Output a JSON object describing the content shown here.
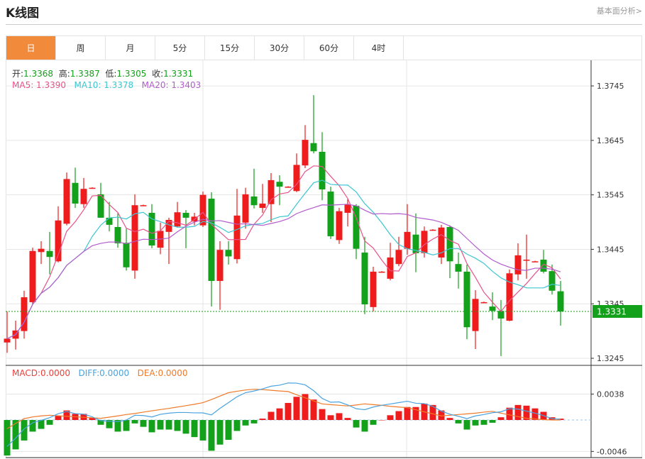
{
  "header": {
    "title": "K线图",
    "link": "基本面分析>"
  },
  "tabs": [
    {
      "label": "日",
      "active": true
    },
    {
      "label": "周"
    },
    {
      "label": "月"
    },
    {
      "label": "5分"
    },
    {
      "label": "15分"
    },
    {
      "label": "30分"
    },
    {
      "label": "60分"
    },
    {
      "label": "4时"
    }
  ],
  "ohlc_info": {
    "open_label": "开:",
    "open": "1.3368",
    "high_label": "高:",
    "high": "1.3387",
    "low_label": "低:",
    "low": "1.3305",
    "close_label": "收:",
    "close": "1.3331"
  },
  "ma_info": {
    "ma5": "MA5: 1.3390",
    "ma10": "MA10: 1.3378",
    "ma20": "MA20: 1.3403"
  },
  "macd_info": {
    "macd": "MACD:0.0000",
    "diff": "DIFF:0.0000",
    "dea": "DEA:0.0000"
  },
  "colors": {
    "up": "#ee1c1c",
    "down": "#13a01a",
    "ma5": "#e8528a",
    "ma10": "#3cc6d0",
    "ma20": "#b25ccc",
    "diff": "#4aa3df",
    "dea": "#f07a2a",
    "accent": "#f28a3c"
  },
  "chart_data": [
    {
      "type": "candlestick",
      "ylim": [
        1.3232,
        1.3792
      ],
      "y_ticks": [
        "1.3745",
        "1.3645",
        "1.3545",
        "1.3445",
        "1.3345",
        "1.3245"
      ],
      "current_price": "1.3331",
      "grid": true,
      "ma_periods": [
        5,
        10,
        20
      ],
      "candles": [
        [
          1.3274,
          1.3331,
          1.3255,
          1.3281
        ],
        [
          1.3281,
          1.3314,
          1.3261,
          1.3296
        ],
        [
          1.3295,
          1.3369,
          1.3281,
          1.3357
        ],
        [
          1.3348,
          1.3448,
          1.3344,
          1.3442
        ],
        [
          1.344,
          1.346,
          1.3418,
          1.3446
        ],
        [
          1.3442,
          1.3477,
          1.3399,
          1.3431
        ],
        [
          1.3423,
          1.3524,
          1.3421,
          1.3498
        ],
        [
          1.3492,
          1.3586,
          1.3489,
          1.3574
        ],
        [
          1.3567,
          1.3595,
          1.3521,
          1.3529
        ],
        [
          1.3528,
          1.3576,
          1.3521,
          1.3556
        ],
        [
          1.3558,
          1.3559,
          1.3557,
          1.3558
        ],
        [
          1.3546,
          1.3567,
          1.3503,
          1.3503
        ],
        [
          1.3503,
          1.3532,
          1.3478,
          1.349
        ],
        [
          1.3486,
          1.3511,
          1.3448,
          1.3456
        ],
        [
          1.3457,
          1.3483,
          1.3406,
          1.3412
        ],
        [
          1.3406,
          1.3546,
          1.3391,
          1.3526
        ],
        [
          1.3526,
          1.3527,
          1.3525,
          1.3526
        ],
        [
          1.3512,
          1.3528,
          1.3447,
          1.3452
        ],
        [
          1.3448,
          1.3494,
          1.3436,
          1.3479
        ],
        [
          1.3477,
          1.3503,
          1.3418,
          1.3499
        ],
        [
          1.3487,
          1.3532,
          1.3485,
          1.3513
        ],
        [
          1.3512,
          1.3517,
          1.3447,
          1.3503
        ],
        [
          1.3496,
          1.3512,
          1.3489,
          1.3505
        ],
        [
          1.3489,
          1.3551,
          1.3486,
          1.3545
        ],
        [
          1.3538,
          1.355,
          1.334,
          1.3387
        ],
        [
          1.3387,
          1.346,
          1.3334,
          1.3444
        ],
        [
          1.3444,
          1.346,
          1.3417,
          1.3432
        ],
        [
          1.3427,
          1.3556,
          1.3419,
          1.3507
        ],
        [
          1.3494,
          1.3558,
          1.3483,
          1.3546
        ],
        [
          1.3542,
          1.3593,
          1.352,
          1.3526
        ],
        [
          1.3521,
          1.3565,
          1.3512,
          1.3529
        ],
        [
          1.3528,
          1.3585,
          1.3495,
          1.3572
        ],
        [
          1.3569,
          1.3581,
          1.3526,
          1.356
        ],
        [
          1.356,
          1.3561,
          1.3559,
          1.356
        ],
        [
          1.3552,
          1.3621,
          1.355,
          1.36
        ],
        [
          1.3599,
          1.3673,
          1.3594,
          1.3646
        ],
        [
          1.364,
          1.3728,
          1.3621,
          1.3625
        ],
        [
          1.3624,
          1.366,
          1.3535,
          1.3555
        ],
        [
          1.3551,
          1.356,
          1.3464,
          1.3469
        ],
        [
          1.3462,
          1.3521,
          1.3455,
          1.3515
        ],
        [
          1.3512,
          1.3537,
          1.3487,
          1.3528
        ],
        [
          1.3525,
          1.3528,
          1.3427,
          1.3446
        ],
        [
          1.3439,
          1.3468,
          1.3326,
          1.3344
        ],
        [
          1.3339,
          1.3413,
          1.3331,
          1.3404
        ],
        [
          1.3404,
          1.3405,
          1.3403,
          1.3404
        ],
        [
          1.3391,
          1.3457,
          1.3388,
          1.343
        ],
        [
          1.3418,
          1.3468,
          1.3414,
          1.3444
        ],
        [
          1.3446,
          1.3528,
          1.3435,
          1.3477
        ],
        [
          1.3472,
          1.3511,
          1.3403,
          1.3438
        ],
        [
          1.3438,
          1.3487,
          1.343,
          1.3479
        ],
        [
          1.3481,
          1.3482,
          1.348,
          1.3481
        ],
        [
          1.343,
          1.349,
          1.3418,
          1.3485
        ],
        [
          1.3486,
          1.3489,
          1.3392,
          1.3423
        ],
        [
          1.3418,
          1.3439,
          1.3373,
          1.3404
        ],
        [
          1.3404,
          1.3417,
          1.328,
          1.3302
        ],
        [
          1.3295,
          1.337,
          1.3262,
          1.3354
        ],
        [
          1.3348,
          1.3349,
          1.3347,
          1.3348
        ],
        [
          1.334,
          1.3366,
          1.3315,
          1.3332
        ],
        [
          1.3332,
          1.3352,
          1.3249,
          1.3318
        ],
        [
          1.3314,
          1.3408,
          1.3313,
          1.3401
        ],
        [
          1.3399,
          1.3456,
          1.3388,
          1.3434
        ],
        [
          1.3426,
          1.3472,
          1.3391,
          1.3426
        ],
        [
          1.3423,
          1.3424,
          1.3422,
          1.3423
        ],
        [
          1.3426,
          1.3444,
          1.3401,
          1.3404
        ],
        [
          1.3405,
          1.3417,
          1.3362,
          1.3369
        ],
        [
          1.3368,
          1.3387,
          1.3305,
          1.3331
        ]
      ]
    },
    {
      "type": "bar+line",
      "ylim": [
        -0.0055,
        0.008
      ],
      "y_ticks": [
        "0.0038",
        "-0.0046"
      ],
      "macd": [
        -0.0052,
        -0.0043,
        -0.003,
        -0.0017,
        -0.0013,
        -0.0007,
        0.0006,
        0.0014,
        0.0009,
        0.0009,
        0.0003,
        -0.0007,
        -0.0012,
        -0.0017,
        -0.0016,
        -0.0005,
        -0.001,
        -0.0018,
        -0.0014,
        -0.0014,
        -0.0016,
        -0.002,
        -0.0025,
        -0.003,
        -0.0045,
        -0.0036,
        -0.0029,
        -0.0016,
        -0.0008,
        -0.0005,
        0.0002,
        0.0012,
        0.0017,
        0.0025,
        0.0034,
        0.0038,
        0.003,
        0.0016,
        0.0007,
        0.001,
        0.0003,
        -0.0011,
        -0.0017,
        -0.0007,
        0.0,
        0.0007,
        0.0013,
        0.0019,
        0.0019,
        0.0024,
        0.0022,
        0.0014,
        0.0003,
        -0.0005,
        -0.0014,
        -0.0008,
        -0.0007,
        -0.0004,
        0.0004,
        0.0018,
        0.0022,
        0.0021,
        0.0017,
        0.0012,
        0.0004,
        0.0002
      ],
      "diff": [
        -0.00387,
        -0.00265,
        -0.0013,
        -0.0004,
        -5e-05,
        0.00035,
        0.00092,
        0.00125,
        0.00093,
        0.00085,
        0.00047,
        -0.0001,
        -0.00018,
        -0.00025,
        0.0,
        0.0007,
        0.00065,
        0.00045,
        0.00083,
        0.001,
        0.0011,
        0.0011,
        0.00105,
        0.00104,
        0.00075,
        0.0017,
        0.00255,
        0.0034,
        0.004,
        0.00425,
        0.00455,
        0.00495,
        0.0051,
        0.00542,
        0.0054,
        0.00515,
        0.0043,
        0.00316,
        0.0026,
        0.00265,
        0.00221,
        0.00165,
        0.00151,
        0.0019,
        0.00215,
        0.00235,
        0.00255,
        0.00275,
        0.00245,
        0.0024,
        0.002,
        0.0013,
        0.00085,
        0.00055,
        0.0002,
        0.0006,
        0.0008,
        0.00107,
        0.0012,
        0.00165,
        0.0016,
        0.0013,
        0.001,
        0.00065,
        0.0002,
        0.0001
      ],
      "dea": [
        -0.00127,
        -0.0005,
        0.0002,
        0.00045,
        0.0006,
        0.0007,
        0.00062,
        0.00055,
        0.00048,
        0.0004,
        0.00032,
        0.00025,
        0.00042,
        0.0006,
        0.0008,
        0.00095,
        0.00115,
        0.00135,
        0.00153,
        0.0017,
        0.0019,
        0.0021,
        0.0023,
        0.00254,
        0.003,
        0.0035,
        0.004,
        0.0042,
        0.0044,
        0.0045,
        0.00445,
        0.00435,
        0.00425,
        0.00417,
        0.0037,
        0.00325,
        0.0028,
        0.00236,
        0.00225,
        0.00215,
        0.00206,
        0.0022,
        0.00236,
        0.00225,
        0.00215,
        0.002,
        0.0019,
        0.0018,
        0.0015,
        0.0012,
        0.0009,
        0.0006,
        0.0007,
        0.0008,
        0.0009,
        0.001,
        0.00115,
        0.00127,
        0.001,
        0.00075,
        0.0005,
        0.00025,
        0.00015,
        5e-05,
        0.0,
        0.0
      ]
    }
  ]
}
